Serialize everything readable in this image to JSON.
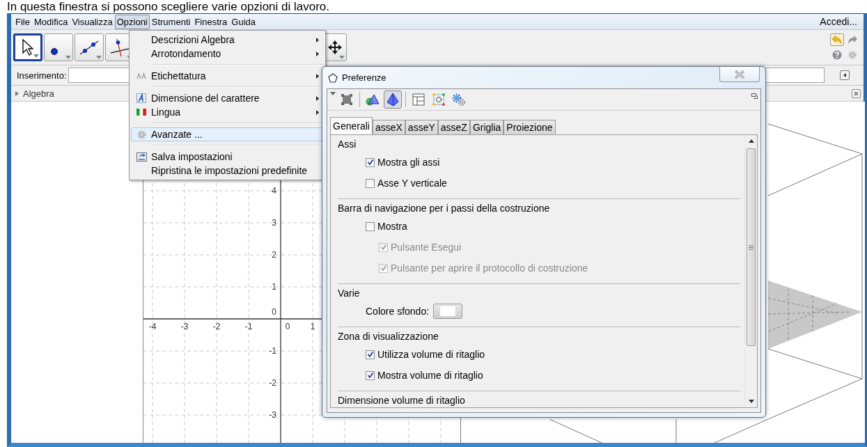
{
  "caption": "In questa finestra si possono scegliere varie opzioni di lavoro.",
  "menubar": {
    "items": [
      {
        "label": "File",
        "selected": false
      },
      {
        "label": "Modifica",
        "selected": false
      },
      {
        "label": "Visualizza",
        "selected": false
      },
      {
        "label": "Opzioni",
        "selected": true
      },
      {
        "label": "Strumenti",
        "selected": false
      },
      {
        "label": "Finestra",
        "selected": false
      },
      {
        "label": "Guida",
        "selected": false
      }
    ],
    "account": "Accedi..."
  },
  "toolbar": {
    "tools": [
      {
        "kind": "move",
        "selected": true
      },
      {
        "kind": "point",
        "selected": false
      },
      {
        "kind": "line",
        "selected": false
      },
      {
        "kind": "perpendicular",
        "selected": false
      },
      {
        "kind": "pan",
        "selected": false
      }
    ]
  },
  "input_bar": {
    "label": "Inserimento:"
  },
  "algebra_view": {
    "title": "Algebra"
  },
  "graphics_view": {
    "x_labels": [
      "-4",
      "-3",
      "-2",
      "-1",
      "0",
      "1"
    ],
    "y_labels": [
      "4",
      "3",
      "2",
      "1",
      "0",
      "-1",
      "-2",
      "-3"
    ]
  },
  "options_menu": {
    "groups": [
      [
        {
          "label": "Descrizioni Algebra",
          "kind": "plain",
          "submenu": true,
          "selected": false
        },
        {
          "label": "Arrotondamento",
          "kind": "plain",
          "submenu": true,
          "selected": false
        }
      ],
      [
        {
          "label": "Etichettatura",
          "kind": "labels",
          "submenu": true,
          "selected": false
        }
      ],
      [
        {
          "label": "Dimensione del carattere",
          "kind": "font",
          "submenu": true,
          "selected": false
        },
        {
          "label": "Lingua",
          "kind": "language",
          "submenu": true,
          "selected": false
        }
      ],
      [
        {
          "label": "Avanzate ...",
          "kind": "advanced",
          "submenu": false,
          "selected": true
        }
      ],
      [
        {
          "label": "Salva impostazioni",
          "kind": "save",
          "submenu": false,
          "selected": false
        },
        {
          "label": "Ripristina le impostazioni predefinite",
          "kind": "plain",
          "submenu": false,
          "selected": false
        }
      ]
    ]
  },
  "preferences": {
    "title": "Preferenze",
    "views": [
      {
        "kind": "objects",
        "selected": false
      },
      {
        "kind": "graphics",
        "selected": false
      },
      {
        "kind": "graphics3d",
        "selected": true
      },
      {
        "kind": "layout",
        "selected": false
      },
      {
        "kind": "defaults",
        "selected": false
      },
      {
        "kind": "advanced",
        "selected": false
      }
    ],
    "tabs": [
      {
        "label": "Generali",
        "selected": true
      },
      {
        "label": "asseX",
        "selected": false
      },
      {
        "label": "asseY",
        "selected": false
      },
      {
        "label": "asseZ",
        "selected": false
      },
      {
        "label": "Griglia",
        "selected": false
      },
      {
        "label": "Proiezione",
        "selected": false
      }
    ],
    "sections": [
      {
        "title": "Assi",
        "rows": [
          {
            "kind": "checkbox",
            "label": "Mostra gli assi",
            "checked": true,
            "disabled": false
          },
          {
            "kind": "checkbox",
            "label": "Asse Y verticale",
            "checked": false,
            "disabled": false
          }
        ]
      },
      {
        "title": "Barra di navigazione per i passi della costruzione",
        "rows": [
          {
            "kind": "checkbox",
            "label": "Mostra",
            "checked": false,
            "disabled": false,
            "children": [
              {
                "kind": "checkbox",
                "label": "Pulsante Esegui",
                "checked": true,
                "disabled": true
              },
              {
                "kind": "checkbox",
                "label": "Pulsante per aprire il protocollo di costruzione",
                "checked": true,
                "disabled": true
              }
            ]
          }
        ]
      },
      {
        "title": "Varie",
        "rows": [
          {
            "kind": "color",
            "label": "Colore sfondo:",
            "color": "#ffffff"
          }
        ]
      },
      {
        "title": "Zona di visualizzazione",
        "rows": [
          {
            "kind": "checkbox",
            "label": "Utilizza volume di ritaglio",
            "checked": true,
            "disabled": false
          },
          {
            "kind": "checkbox",
            "label": "Mostra volume di ritaglio",
            "checked": true,
            "disabled": false
          }
        ]
      },
      {
        "title": "Dimensione volume di ritaglio"
      }
    ]
  }
}
